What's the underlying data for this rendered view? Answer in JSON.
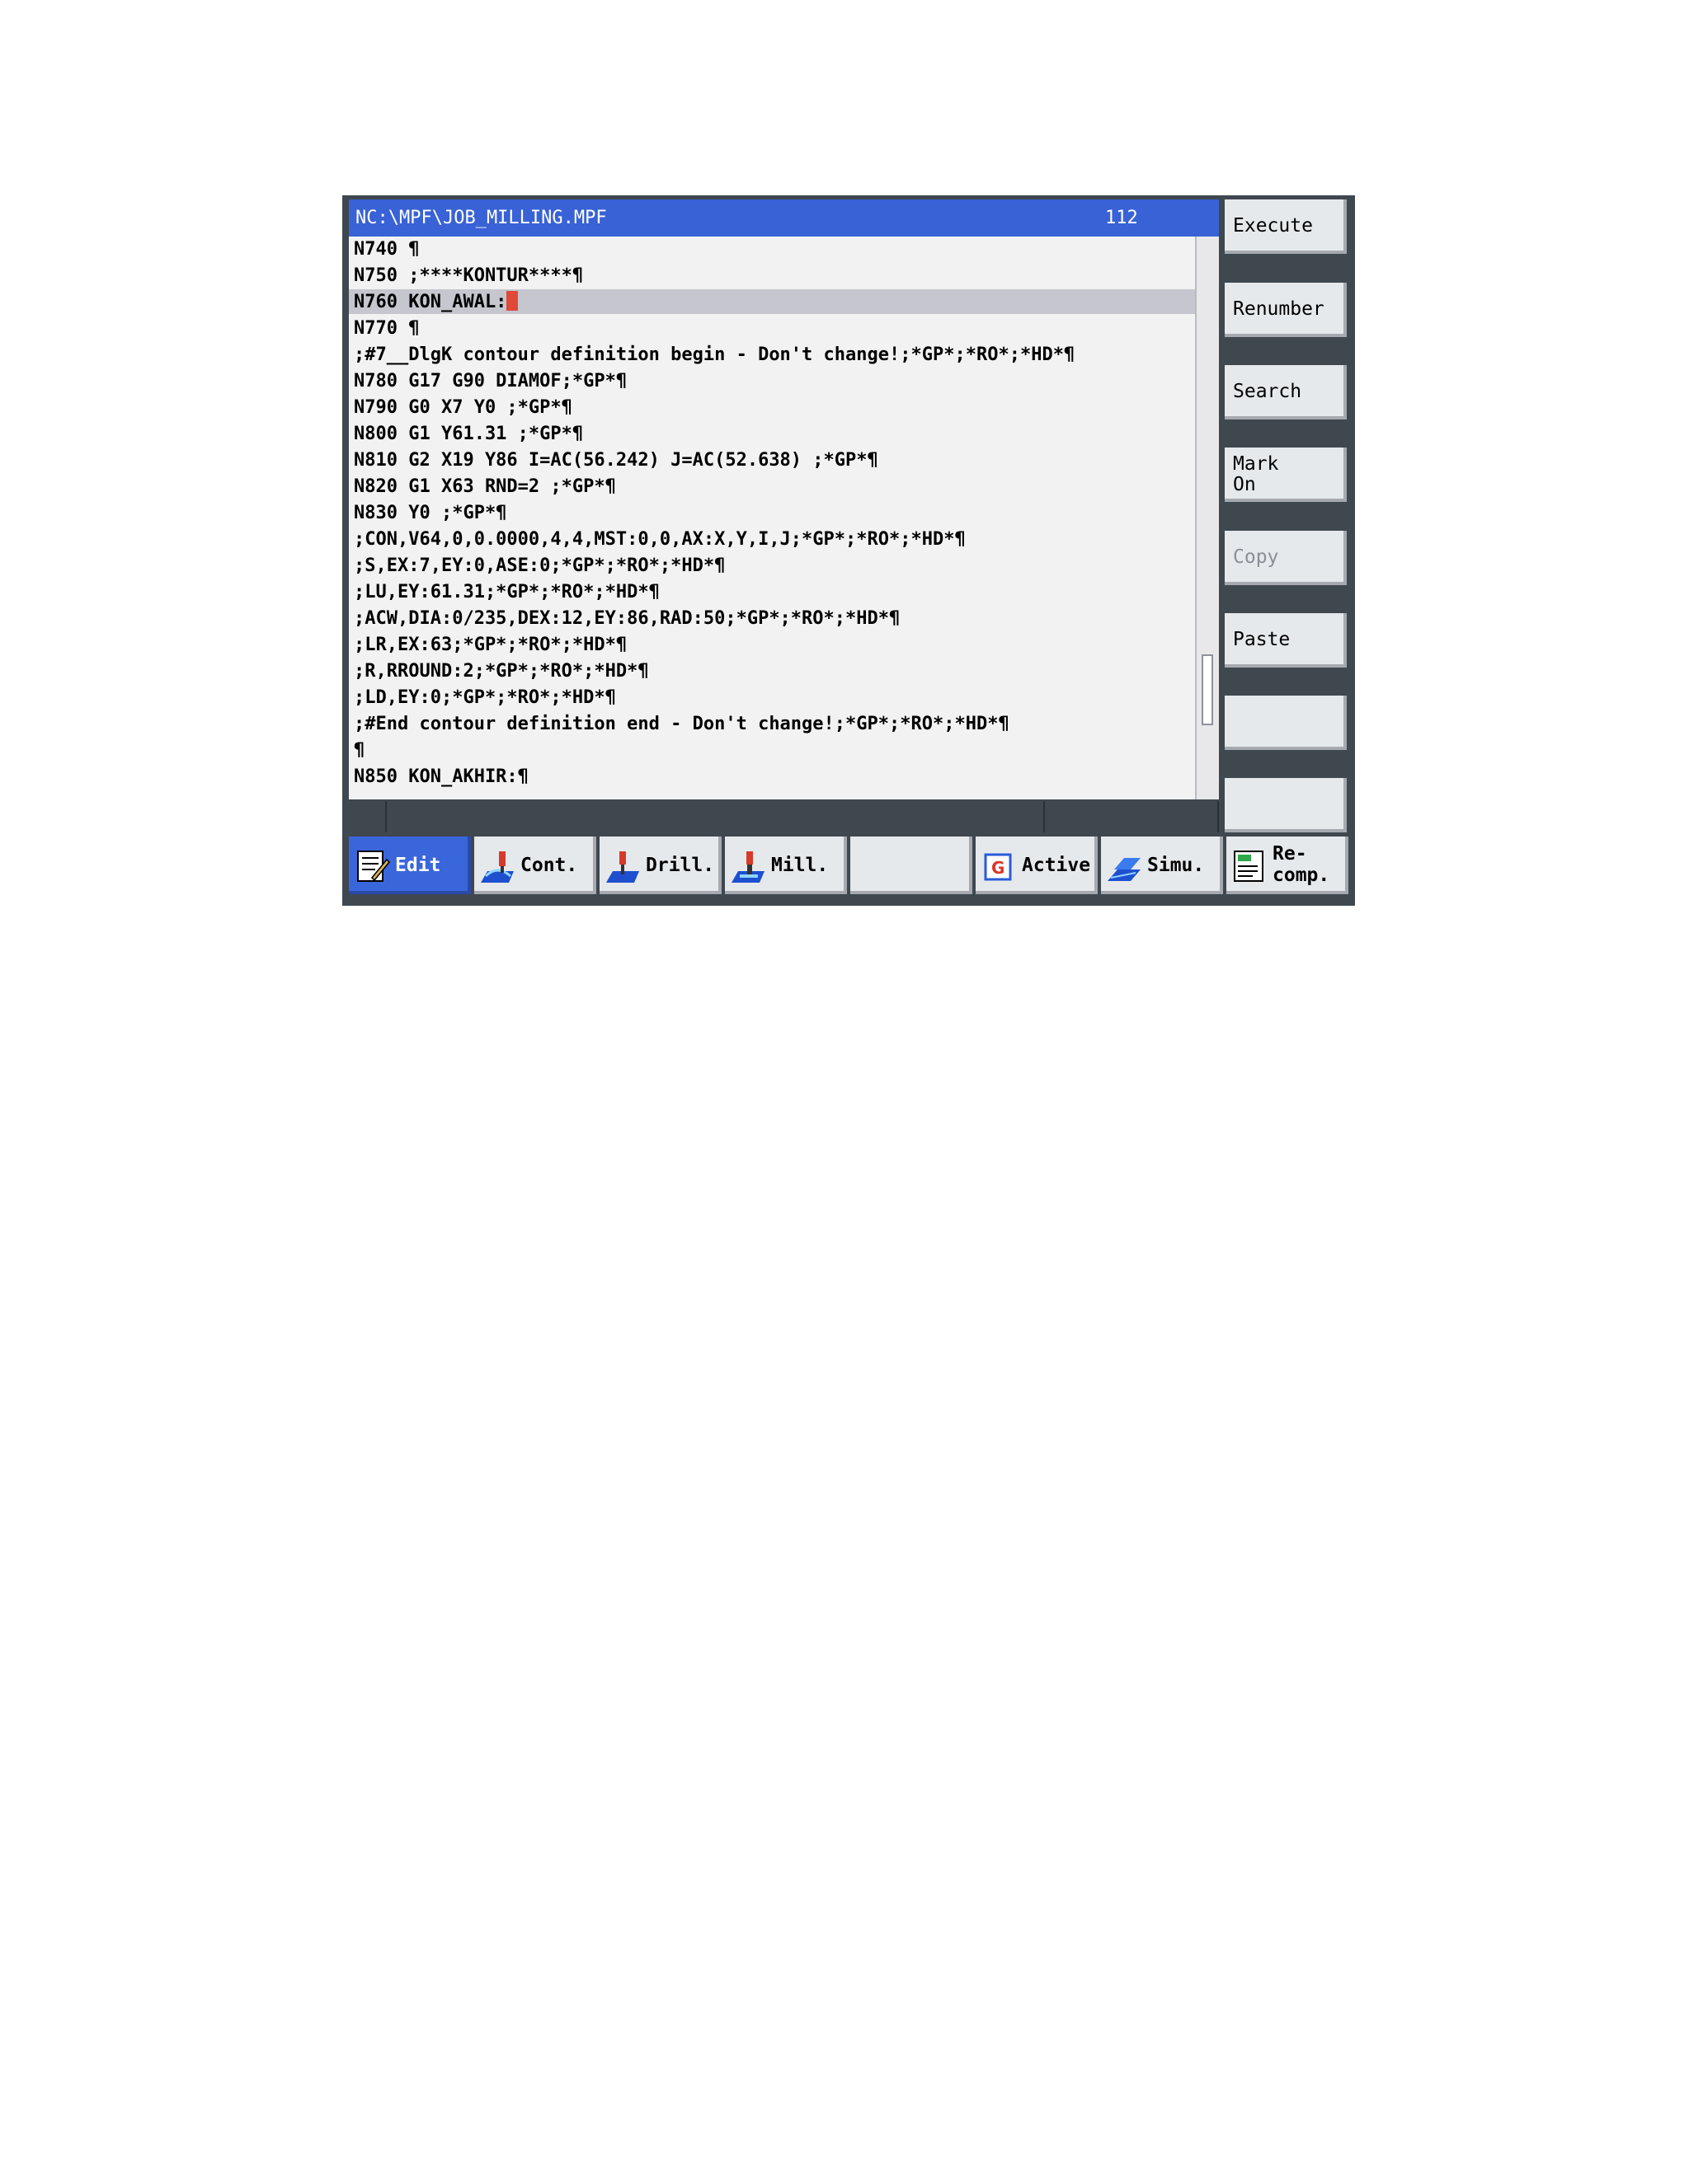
{
  "editor": {
    "file_path": "NC:\\MPF\\JOB_MILLING.MPF",
    "line_count": "112",
    "lines": [
      "N740 ¶",
      "N750 ;****KONTUR****¶",
      "N760 KON_AWAL:",
      "N770 ¶",
      ";#7__DlgK contour definition begin - Don't change!;*GP*;*RO*;*HD*¶",
      "N780 G17 G90 DIAMOF;*GP*¶",
      "N790 G0 X7 Y0 ;*GP*¶",
      "N800 G1 Y61.31 ;*GP*¶",
      "N810 G2 X19 Y86 I=AC(56.242) J=AC(52.638) ;*GP*¶",
      "N820 G1 X63 RND=2 ;*GP*¶",
      "N830 Y0 ;*GP*¶",
      ";CON,V64,0,0.0000,4,4,MST:0,0,AX:X,Y,I,J;*GP*;*RO*;*HD*¶",
      ";S,EX:7,EY:0,ASE:0;*GP*;*RO*;*HD*¶",
      ";LU,EY:61.31;*GP*;*RO*;*HD*¶",
      ";ACW,DIA:0/235,DEX:12,EY:86,RAD:50;*GP*;*RO*;*HD*¶",
      ";LR,EX:63;*GP*;*RO*;*HD*¶",
      ";R,RROUND:2;*GP*;*RO*;*HD*¶",
      ";LD,EY:0;*GP*;*RO*;*HD*¶",
      ";#End contour definition end - Don't change!;*GP*;*RO*;*HD*¶",
      "¶",
      "N850 KON_AKHIR:¶"
    ],
    "selected_line_index": 2
  },
  "vertical_softkeys": {
    "execute": "Execute",
    "renumber": "Renumber",
    "search": "Search",
    "mark_line1": "Mark",
    "mark_line2": "On",
    "copy": "Copy",
    "paste": "Paste"
  },
  "horizontal_softkeys": {
    "edit": "Edit",
    "cont": "Cont.",
    "drill": "Drill.",
    "mill": "Mill.",
    "active": "Active",
    "simu": "Simu.",
    "recomp_line1": "Re-",
    "recomp_line2": "comp."
  },
  "colors": {
    "title_bar": "#3862d6",
    "active_softkey": "#3a66db",
    "cursor": "#e0493a",
    "selection": "#c6c6ce"
  }
}
